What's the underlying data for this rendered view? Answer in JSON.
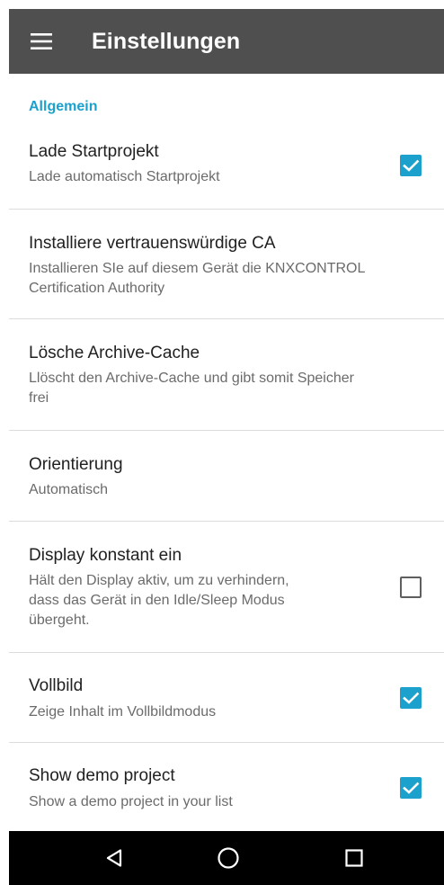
{
  "appbar": {
    "title": "Einstellungen",
    "menu_icon": "hamburger-menu-icon"
  },
  "section": {
    "header": "Allgemein"
  },
  "preferences": [
    {
      "title": "Lade Startprojekt",
      "summary": "Lade automatisch Startprojekt",
      "checkbox": true
    },
    {
      "title": "Installiere vertrauenswürdige CA",
      "summary": "Installieren SIe auf diesem Gerät die KNXCONTROL\nCertification Authority",
      "checkbox": null
    },
    {
      "title": "Lösche Archive-Cache",
      "summary": "Llöscht den Archive-Cache und gibt somit Speicher\nfrei",
      "checkbox": null
    },
    {
      "title": "Orientierung",
      "summary": "Automatisch",
      "checkbox": null
    },
    {
      "title": "Display konstant ein",
      "summary": "Hält den Display aktiv, um zu verhindern,\ndass das Gerät in den Idle/Sleep Modus\nübergeht.",
      "checkbox": false
    },
    {
      "title": "Vollbild",
      "summary": "Zeige Inhalt im Vollbildmodus",
      "checkbox": true
    },
    {
      "title": "Show demo project",
      "summary": "Show a demo project in your list",
      "checkbox": true
    }
  ],
  "navbar": {
    "back_icon": "back-triangle-icon",
    "home_icon": "home-circle-icon",
    "recents_icon": "recents-square-icon"
  },
  "colors": {
    "appbar": "#4f4f4f",
    "accent": "#1ba1cc",
    "navbar": "#000000"
  }
}
